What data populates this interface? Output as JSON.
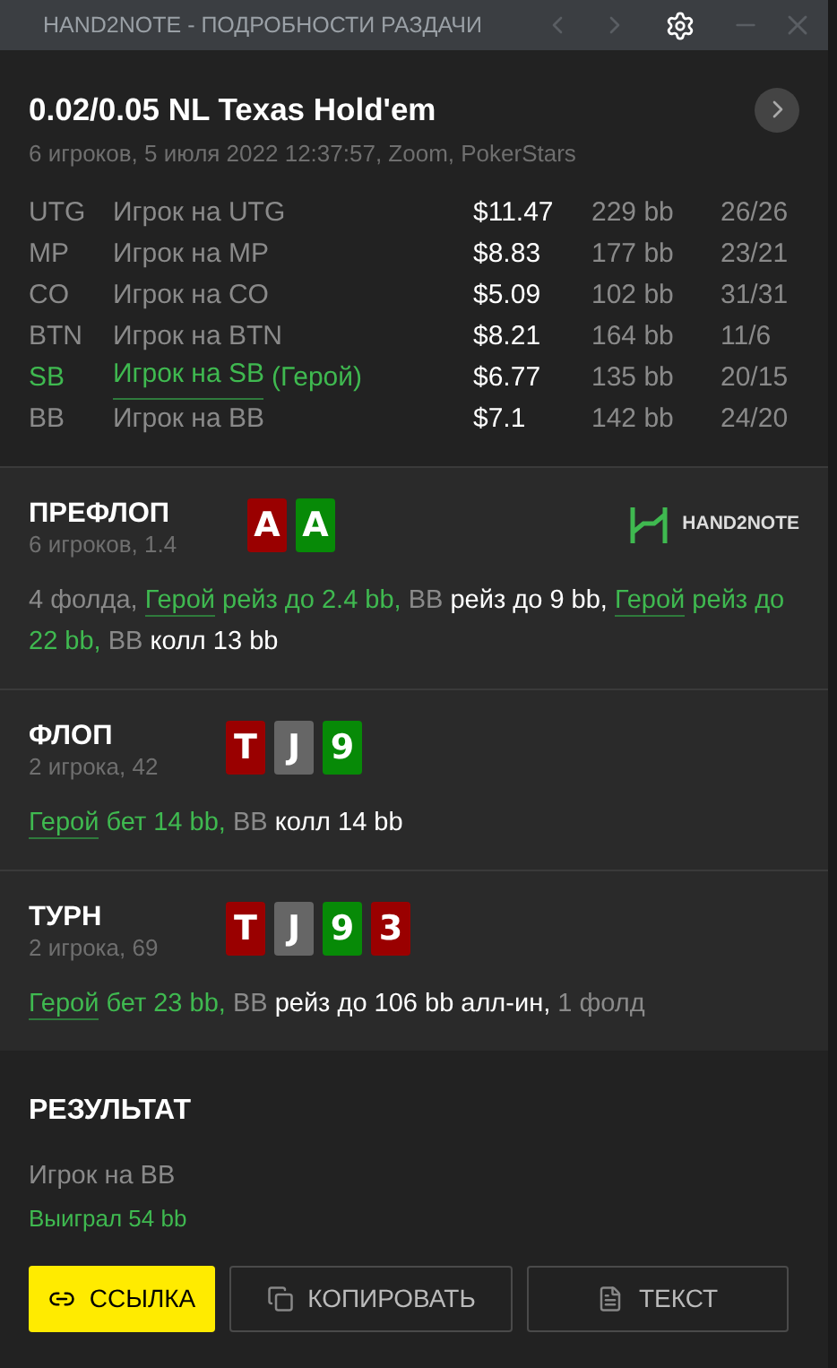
{
  "window": {
    "title": "HAND2NOTE - ПОДРОБНОСТИ РАЗДАЧИ"
  },
  "header": {
    "title": "0.02/0.05 NL Texas Hold'em",
    "subtitle": "6 игроков, 5 июля 2022 12:37:57, Zoom, PokerStars"
  },
  "players": [
    {
      "position": "UTG",
      "name": "Игрок на UTG",
      "hero": false,
      "stack": "$11.47",
      "bb": "229 bb",
      "stats": "26/26"
    },
    {
      "position": "MP",
      "name": "Игрок на MP",
      "hero": false,
      "stack": "$8.83",
      "bb": "177 bb",
      "stats": "23/21"
    },
    {
      "position": "CO",
      "name": "Игрок на CO",
      "hero": false,
      "stack": "$5.09",
      "bb": "102 bb",
      "stats": "31/31"
    },
    {
      "position": "BTN",
      "name": "Игрок на BTN",
      "hero": false,
      "stack": "$8.21",
      "bb": "164 bb",
      "stats": "11/6"
    },
    {
      "position": "SB",
      "name": "Игрок на SB",
      "hero_tag": "(Герой)",
      "hero": true,
      "stack": "$6.77",
      "bb": "135 bb",
      "stats": "20/15"
    },
    {
      "position": "BB",
      "name": "Игрок на BB",
      "hero": false,
      "stack": "$7.1",
      "bb": "142 bb",
      "stats": "24/20"
    }
  ],
  "streets": [
    {
      "name": "ПРЕФЛОП",
      "info": "6 игроков, 1.4",
      "logo": "HAND2NOTE",
      "cards": [
        {
          "rank": "A",
          "color": "#9a0000"
        },
        {
          "rank": "A",
          "color": "#078a07"
        }
      ],
      "actions": [
        {
          "kind": "muted",
          "text": "4 фолда, "
        },
        {
          "kind": "hero_link",
          "text": "Герой"
        },
        {
          "kind": "hero",
          "text": " рейз до 2.4 bb, "
        },
        {
          "kind": "muted",
          "text": "BB"
        },
        {
          "kind": "action",
          "text": " рейз до 9 bb, "
        },
        {
          "kind": "hero_link",
          "text": "Герой"
        },
        {
          "kind": "hero",
          "text": " рейз до 22 bb, "
        },
        {
          "kind": "muted",
          "text": "BB"
        },
        {
          "kind": "action",
          "text": " колл 13 bb"
        }
      ]
    },
    {
      "name": "ФЛОП",
      "info": "2 игрока, 42",
      "cards": [
        {
          "rank": "T",
          "color": "#9a0000"
        },
        {
          "rank": "J",
          "color": "#666666"
        },
        {
          "rank": "9",
          "color": "#078a07"
        }
      ],
      "actions": [
        {
          "kind": "hero_link",
          "text": "Герой"
        },
        {
          "kind": "hero",
          "text": " бет 14 bb, "
        },
        {
          "kind": "muted",
          "text": "BB"
        },
        {
          "kind": "action",
          "text": " колл 14 bb"
        }
      ]
    },
    {
      "name": "ТУРН",
      "info": "2 игрока, 69",
      "cards": [
        {
          "rank": "T",
          "color": "#9a0000"
        },
        {
          "rank": "J",
          "color": "#666666"
        },
        {
          "rank": "9",
          "color": "#078a07"
        },
        {
          "rank": "3",
          "color": "#9a0000"
        }
      ],
      "actions": [
        {
          "kind": "hero_link",
          "text": "Герой"
        },
        {
          "kind": "hero",
          "text": " бет 23 bb, "
        },
        {
          "kind": "muted",
          "text": "BB"
        },
        {
          "kind": "action",
          "text": " рейз до 106 bb алл-ин, "
        },
        {
          "kind": "muted",
          "text": "1 фолд"
        }
      ]
    }
  ],
  "result": {
    "title": "РЕЗУЛЬТАТ",
    "player": "Игрок на BB",
    "outcome": "Выиграл 54 bb"
  },
  "buttons": [
    {
      "kind": "link",
      "label": "ССЫЛКА"
    },
    {
      "kind": "copy",
      "label": "КОПИРОВАТЬ"
    },
    {
      "kind": "text",
      "label": "ТЕКСТ"
    }
  ]
}
